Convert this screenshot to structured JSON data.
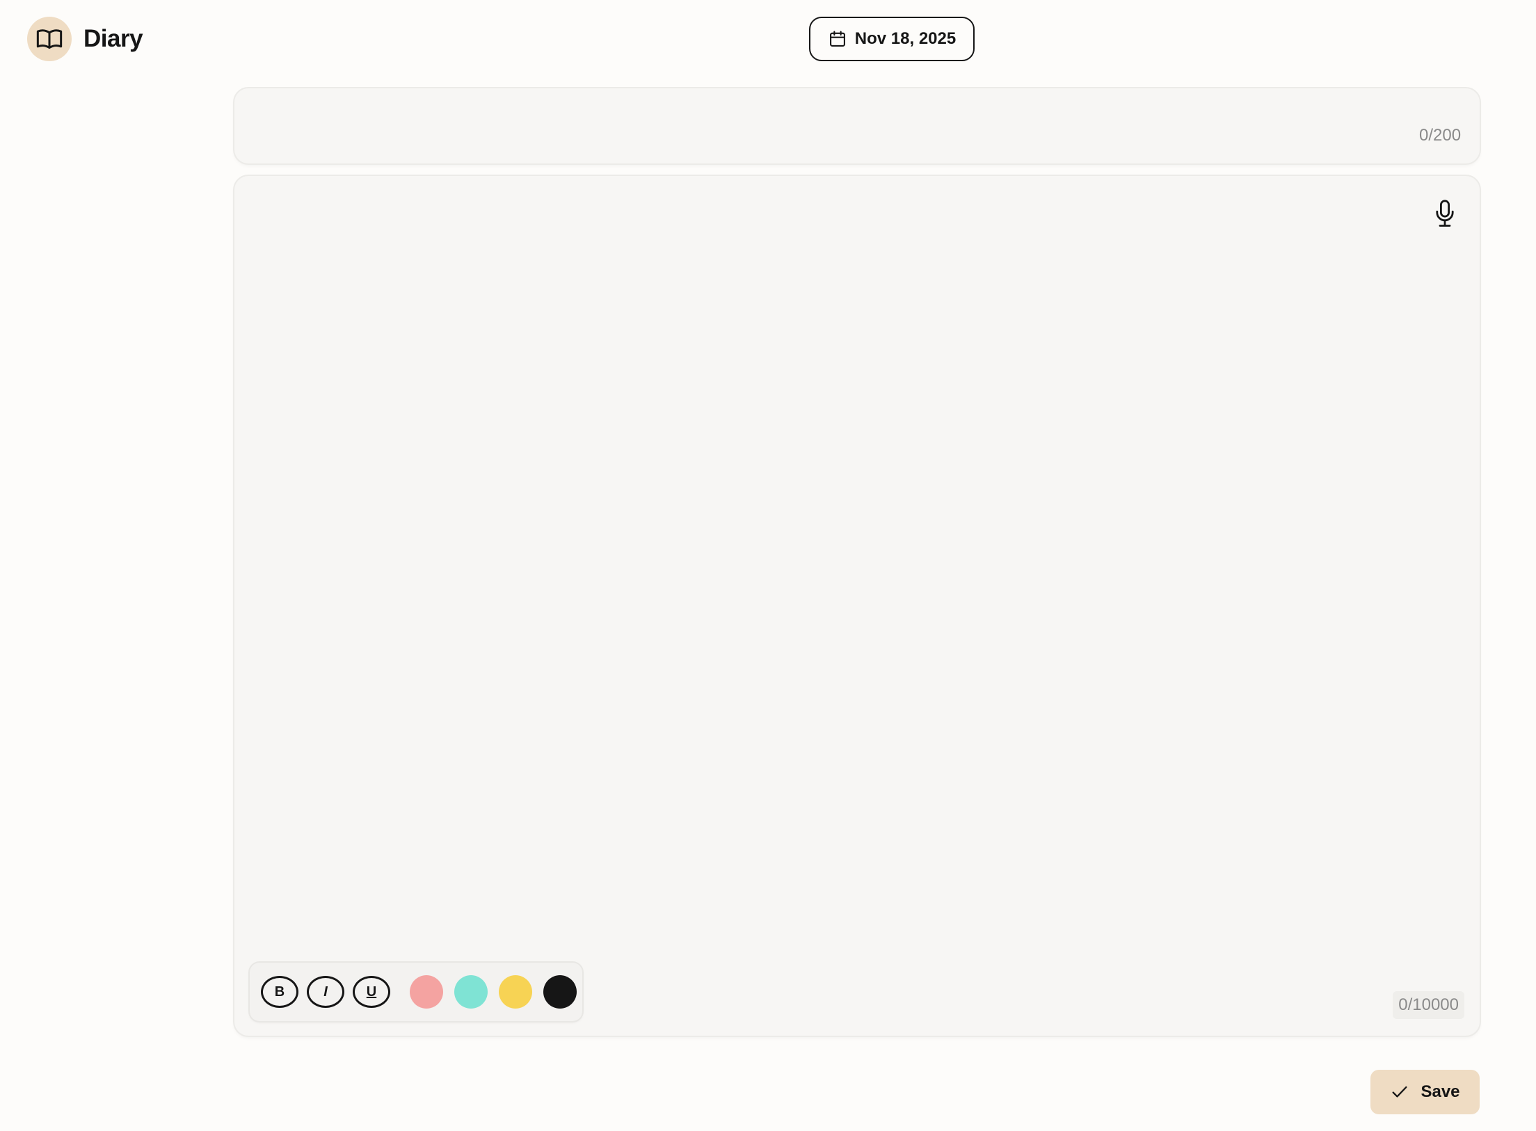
{
  "header": {
    "app_title": "Diary",
    "logo_icon": "open-book-icon",
    "date_label": "Nov 18, 2025",
    "date_icon": "calendar-icon"
  },
  "entry": {
    "title_value": "",
    "title_counter": "0/200",
    "body_value": "",
    "body_counter": "0/10000",
    "mic_icon": "microphone-icon"
  },
  "toolbar": {
    "bold_label": "B",
    "italic_label": "I",
    "underline_label": "U",
    "colors": [
      "#f4a3a1",
      "#7fe3d4",
      "#f7d354",
      "#161616"
    ]
  },
  "actions": {
    "save_label": "Save",
    "save_icon": "check-icon"
  },
  "theme": {
    "accent": "#efdcc3",
    "background": "#fdfcfa",
    "card": "#f7f6f4"
  }
}
